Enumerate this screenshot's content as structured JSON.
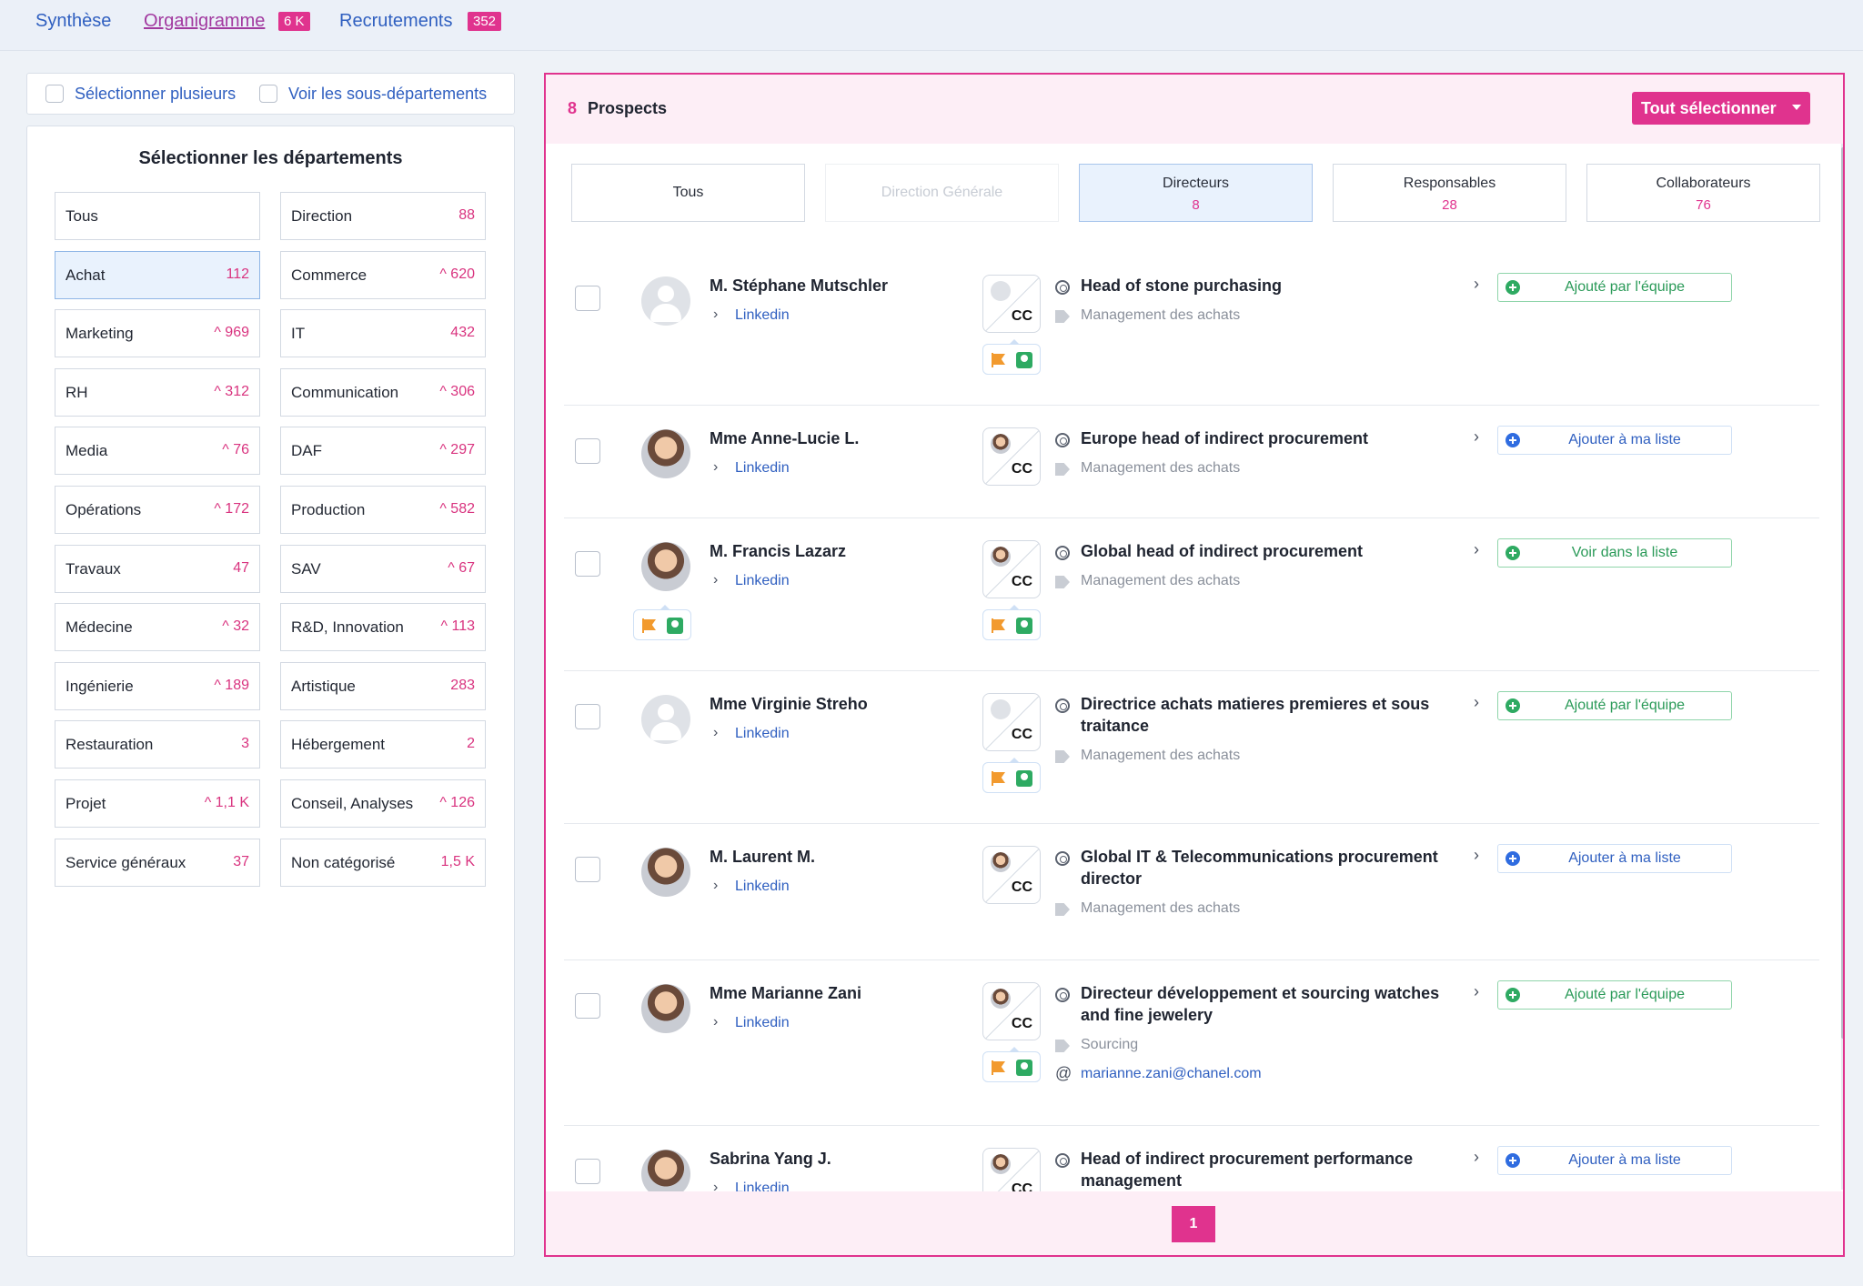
{
  "nav": {
    "tabs": [
      {
        "label": "Synthèse"
      },
      {
        "label": "Organigramme",
        "badge": "6 K"
      },
      {
        "label": "Recrutements",
        "badge": "352"
      }
    ]
  },
  "options": {
    "select_multiple": "Sélectionner plusieurs",
    "show_subdepartments": "Voir les sous-départements"
  },
  "departments": {
    "title": "Sélectionner les départements",
    "items": [
      {
        "name": "Tous",
        "count": ""
      },
      {
        "name": "Direction",
        "count": "88"
      },
      {
        "name": "Achat",
        "count": "112"
      },
      {
        "name": "Commerce",
        "count": "^ 620"
      },
      {
        "name": "Marketing",
        "count": "^ 969"
      },
      {
        "name": "IT",
        "count": "432"
      },
      {
        "name": "RH",
        "count": "^ 312"
      },
      {
        "name": "Communication",
        "count": "^ 306"
      },
      {
        "name": "Media",
        "count": "^ 76"
      },
      {
        "name": "DAF",
        "count": "^ 297"
      },
      {
        "name": "Opérations",
        "count": "^ 172"
      },
      {
        "name": "Production",
        "count": "^ 582"
      },
      {
        "name": "Travaux",
        "count": "47"
      },
      {
        "name": "SAV",
        "count": "^ 67"
      },
      {
        "name": "Médecine",
        "count": "^ 32"
      },
      {
        "name": "R&D, Innovation",
        "count": "^ 113"
      },
      {
        "name": "Ingénierie",
        "count": "^ 189"
      },
      {
        "name": "Artistique",
        "count": "283"
      },
      {
        "name": "Restauration",
        "count": "3"
      },
      {
        "name": "Hébergement",
        "count": "2"
      },
      {
        "name": "Projet",
        "count": "^ 1,1 K"
      },
      {
        "name": "Conseil, Analyses",
        "count": "^ 126"
      },
      {
        "name": "Service généraux",
        "count": "37"
      },
      {
        "name": "Non catégorisé",
        "count": "1,5 K"
      }
    ]
  },
  "prospects": {
    "count": "8",
    "title": "Prospects",
    "select_all": "Tout sélectionner",
    "filters": [
      {
        "label": "Tous",
        "count": ""
      },
      {
        "label": "Direction Générale",
        "count": ""
      },
      {
        "label": "Directeurs",
        "count": "8"
      },
      {
        "label": "Responsables",
        "count": "28"
      },
      {
        "label": "Collaborateurs",
        "count": "76"
      }
    ],
    "rows": [
      {
        "name": "M. Stéphane Mutschler",
        "link": "Linkedin",
        "title": "Head of stone purchasing",
        "category": "Management des achats",
        "email": "",
        "action": "Ajouté par l'équipe"
      },
      {
        "name": "Mme Anne-Lucie L.",
        "link": "Linkedin",
        "title": "Europe head of indirect procurement",
        "category": "Management des achats",
        "email": "",
        "action": "Ajouter à ma liste"
      },
      {
        "name": "M. Francis Lazarz",
        "link": "Linkedin",
        "title": "Global head of indirect procurement",
        "category": "Management des achats",
        "email": "",
        "action": "Voir dans la liste"
      },
      {
        "name": "Mme Virginie Streho",
        "link": "Linkedin",
        "title": "Directrice achats matieres premieres et sous traitance",
        "category": "Management des achats",
        "email": "",
        "action": "Ajouté par l'équipe"
      },
      {
        "name": "M. Laurent M.",
        "link": "Linkedin",
        "title": "Global IT & Telecommunications procurement director",
        "category": "Management des achats",
        "email": "",
        "action": "Ajouter à ma liste"
      },
      {
        "name": "Mme Marianne Zani",
        "link": "Linkedin",
        "title": "Directeur développement et sourcing watches and fine jewelery",
        "category": "Sourcing",
        "email": "marianne.zani@chanel.com",
        "action": "Ajouté par l'équipe"
      },
      {
        "name": "Sabrina Yang J.",
        "link": "Linkedin",
        "title": "Head of indirect procurement performance management",
        "category": "",
        "email": "",
        "action": "Ajouter à ma liste"
      }
    ],
    "page": "1"
  },
  "icons": {
    "company_logo": "chanel-logo-icon",
    "flag": "flag-icon",
    "person": "person-icon",
    "target": "target-icon",
    "tag": "tag-icon",
    "at": "at-icon"
  },
  "colors": {
    "accent_pink": "#e0338e",
    "link_blue": "#2f5fc0",
    "green": "#2eaa62"
  }
}
